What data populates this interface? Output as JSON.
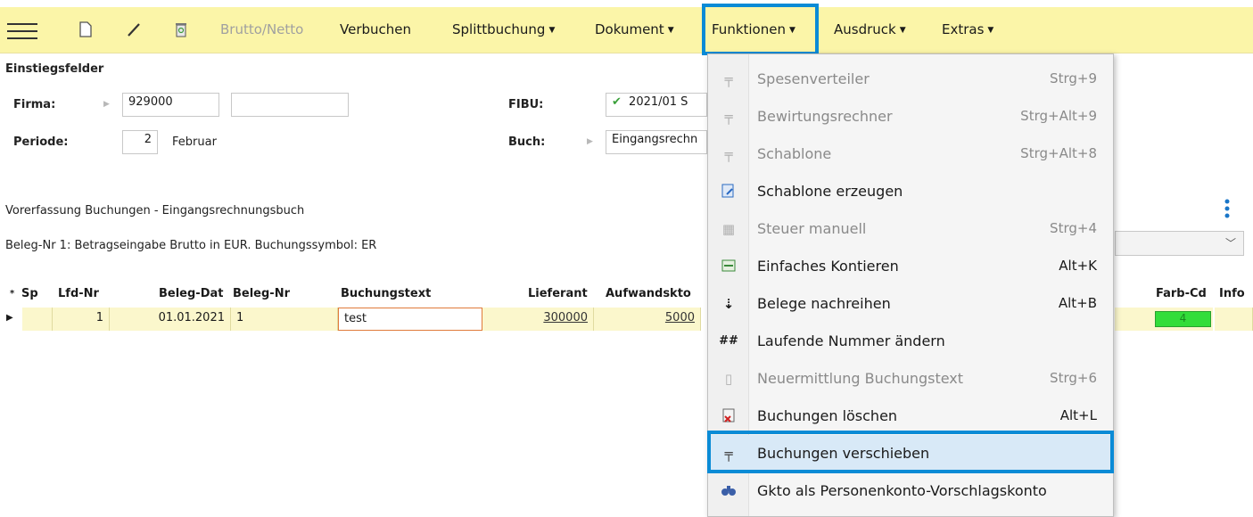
{
  "toolbar": {
    "brutto_netto": "Brutto/Netto",
    "verbuchen": "Verbuchen",
    "splittbuchung": "Splittbuchung",
    "dokument": "Dokument",
    "funktionen": "Funktionen",
    "ausdruck": "Ausdruck",
    "extras": "Extras"
  },
  "entry": {
    "section_title": "Einstiegsfelder",
    "firma_label": "Firma:",
    "firma_value": "929000",
    "periode_label": "Periode:",
    "periode_value": "2",
    "periode_month": "Februar",
    "fibu_label": "FIBU:",
    "fibu_value": "2021/01 S",
    "buch_label": "Buch:",
    "buch_value": "Eingangsrechn"
  },
  "vorerfassung": {
    "title": "Vorerfassung Buchungen - Eingangsrechnungsbuch",
    "info": "Beleg-Nr 1: Betragseingabe Brutto in EUR. Buchungssymbol: ER"
  },
  "grid": {
    "headers": {
      "sp": "Sp",
      "lfd_nr": "Lfd-Nr",
      "beleg_dat": "Beleg-Dat",
      "beleg_nr": "Beleg-Nr",
      "buchungstext": "Buchungstext",
      "lieferant": "Lieferant",
      "aufwandskto": "Aufwandskto",
      "farb_cd": "Farb-Cd",
      "info": "Info"
    },
    "row": {
      "lfd_nr": "1",
      "beleg_dat": "01.01.2021",
      "beleg_nr": "1",
      "buchungstext": "test",
      "lieferant": "300000",
      "aufwandskto": "5000",
      "farb_cd": "4"
    }
  },
  "menu": {
    "items": [
      {
        "label": "Spesenverteiler",
        "shortcut": "Strg+9",
        "icon": "pin-icon",
        "enabled": false
      },
      {
        "label": "Bewirtungsrechner",
        "shortcut": "Strg+Alt+9",
        "icon": "pin-icon",
        "enabled": false
      },
      {
        "label": "Schablone",
        "shortcut": "Strg+Alt+8",
        "icon": "pin-icon",
        "enabled": false
      },
      {
        "label": "Schablone erzeugen",
        "shortcut": "",
        "icon": "template-icon",
        "enabled": true
      },
      {
        "label": "Steuer manuell",
        "shortcut": "Strg+4",
        "icon": "calculator-icon",
        "enabled": false
      },
      {
        "label": "Einfaches Kontieren",
        "shortcut": "Alt+K",
        "icon": "account-icon",
        "enabled": true
      },
      {
        "label": "Belege nachreihen",
        "shortcut": "Alt+B",
        "icon": "sort-icon",
        "enabled": true
      },
      {
        "label": "Laufende Nummer ändern",
        "shortcut": "",
        "icon": "hash-icon",
        "enabled": true
      },
      {
        "label": "Neuermittlung Buchungstext",
        "shortcut": "Strg+6",
        "icon": "document-icon",
        "enabled": false
      },
      {
        "label": "Buchungen löschen",
        "shortcut": "Alt+L",
        "icon": "delete-doc-icon",
        "enabled": true
      },
      {
        "label": "Buchungen verschieben",
        "shortcut": "",
        "icon": "pin-icon",
        "enabled": true
      },
      {
        "label": "Gkto als Personenkonto-Vorschlagskonto",
        "shortcut": "",
        "icon": "binoculars-icon",
        "enabled": true
      }
    ]
  },
  "colors": {
    "toolbar_bg": "#fbf5a8",
    "highlight_border": "#0a8bd6",
    "row_bg": "#fbf7cc",
    "farb_green": "#33dd3a"
  }
}
